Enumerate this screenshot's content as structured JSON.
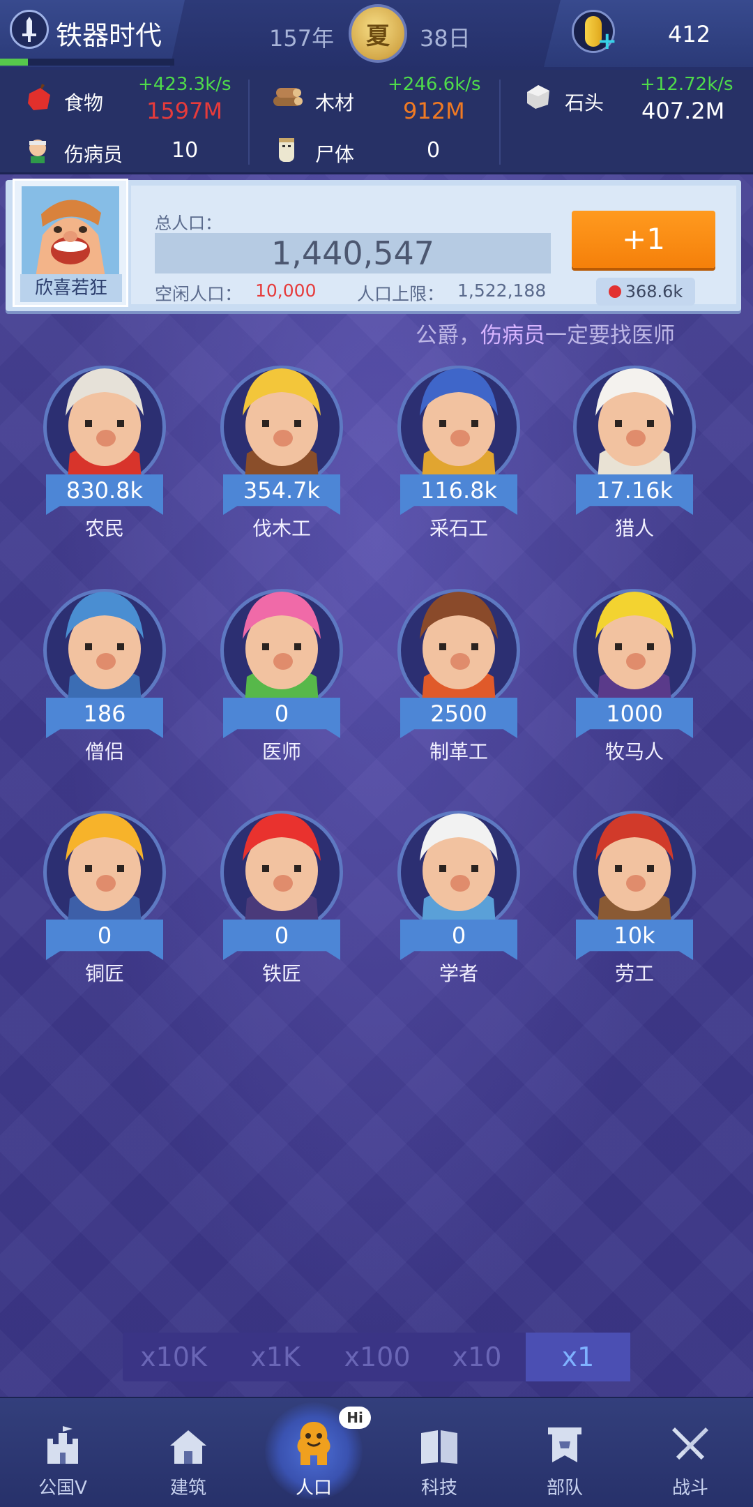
{
  "header": {
    "era_title": "铁器时代",
    "era_progress": 0.16,
    "year": "157年",
    "season": "夏",
    "day": "38日",
    "gems": "412"
  },
  "resources": {
    "food": {
      "label": "食物",
      "rate": "+423.3k/s",
      "amount": "1597M"
    },
    "wood": {
      "label": "木材",
      "rate": "+246.6k/s",
      "amount": "912M"
    },
    "stone": {
      "label": "石头",
      "rate": "+12.72k/s",
      "amount": "407.2M"
    },
    "injured": {
      "label": "伤病员",
      "value": "10"
    },
    "corpse": {
      "label": "尸体",
      "value": "0"
    }
  },
  "population": {
    "mood": "欣喜若狂",
    "total_label": "总人口：",
    "total": "1,440,547",
    "idle_label": "空闲人口：",
    "idle": "10,000",
    "cap_label": "人口上限：",
    "cap": "1,522,188",
    "add_button": "+1",
    "add_cost": "368.6k"
  },
  "marquee": {
    "pre": "公爵，",
    "highlight": "伤病员",
    "post": "一定要找医师"
  },
  "workers": [
    {
      "name": "农民",
      "count": "830.8k"
    },
    {
      "name": "伐木工",
      "count": "354.7k"
    },
    {
      "name": "采石工",
      "count": "116.8k"
    },
    {
      "name": "猎人",
      "count": "17.16k"
    },
    {
      "name": "僧侣",
      "count": "186"
    },
    {
      "name": "医师",
      "count": "0"
    },
    {
      "name": "制革工",
      "count": "2500"
    },
    {
      "name": "牧马人",
      "count": "1000"
    },
    {
      "name": "铜匠",
      "count": "0"
    },
    {
      "name": "铁匠",
      "count": "0"
    },
    {
      "name": "学者",
      "count": "0"
    },
    {
      "name": "劳工",
      "count": "10k"
    }
  ],
  "multiplier": [
    "x10K",
    "x1K",
    "x100",
    "x10",
    "x1"
  ],
  "multiplier_active": "x1",
  "nav": [
    {
      "label": "公国V",
      "icon": "castle-icon"
    },
    {
      "label": "建筑",
      "icon": "house-icon"
    },
    {
      "label": "人口",
      "icon": "people-icon",
      "bubble": "Hi"
    },
    {
      "label": "科技",
      "icon": "book-icon"
    },
    {
      "label": "部队",
      "icon": "banner-icon"
    },
    {
      "label": "战斗",
      "icon": "swords-icon"
    }
  ],
  "colors": {
    "accent": "#f5800a",
    "rate_green": "#4fdc4a",
    "food_red": "#e63b3b",
    "wood_orange": "#f07a23"
  }
}
